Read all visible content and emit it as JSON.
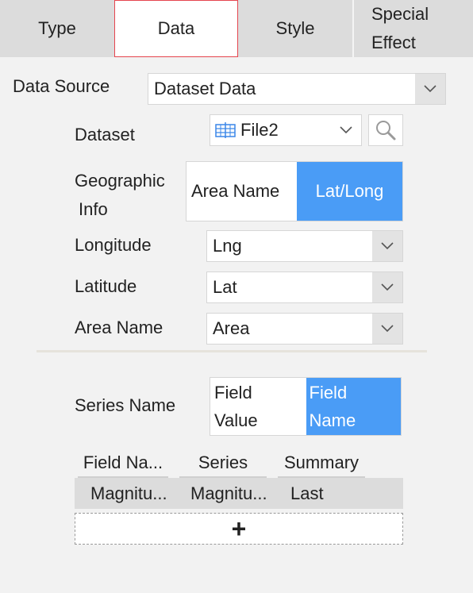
{
  "tabs": [
    "Type",
    "Data",
    "Style",
    "Special Effect"
  ],
  "tab_special_line1": "Special",
  "tab_special_line2": "Effect",
  "data_source": {
    "label": "Data Source",
    "value": "Dataset Data"
  },
  "dataset": {
    "label": "Dataset",
    "value": "File2"
  },
  "geo": {
    "label_line1": "Geographic",
    "label_line2": "Info",
    "options": [
      "Area Name",
      "Lat/Long"
    ],
    "selected": "Lat/Long"
  },
  "longitude": {
    "label": "Longitude",
    "value": "Lng"
  },
  "latitude": {
    "label": "Latitude",
    "value": "Lat"
  },
  "area_name": {
    "label": "Area Name",
    "value": "Area"
  },
  "series_name": {
    "label": "Series Name",
    "opt1_line1": "Field",
    "opt1_line2": "Value",
    "opt2_line1": "Field",
    "opt2_line2": "Name",
    "selected": "Field Name"
  },
  "table": {
    "headers": [
      "Field Na...",
      "Series",
      "Summary"
    ],
    "row": [
      "Magnitu...",
      "Magnitu...",
      "Last"
    ]
  },
  "add_symbol": "+",
  "colors": {
    "accent": "#4a9cf6",
    "active_tab_border": "#e5454e"
  }
}
